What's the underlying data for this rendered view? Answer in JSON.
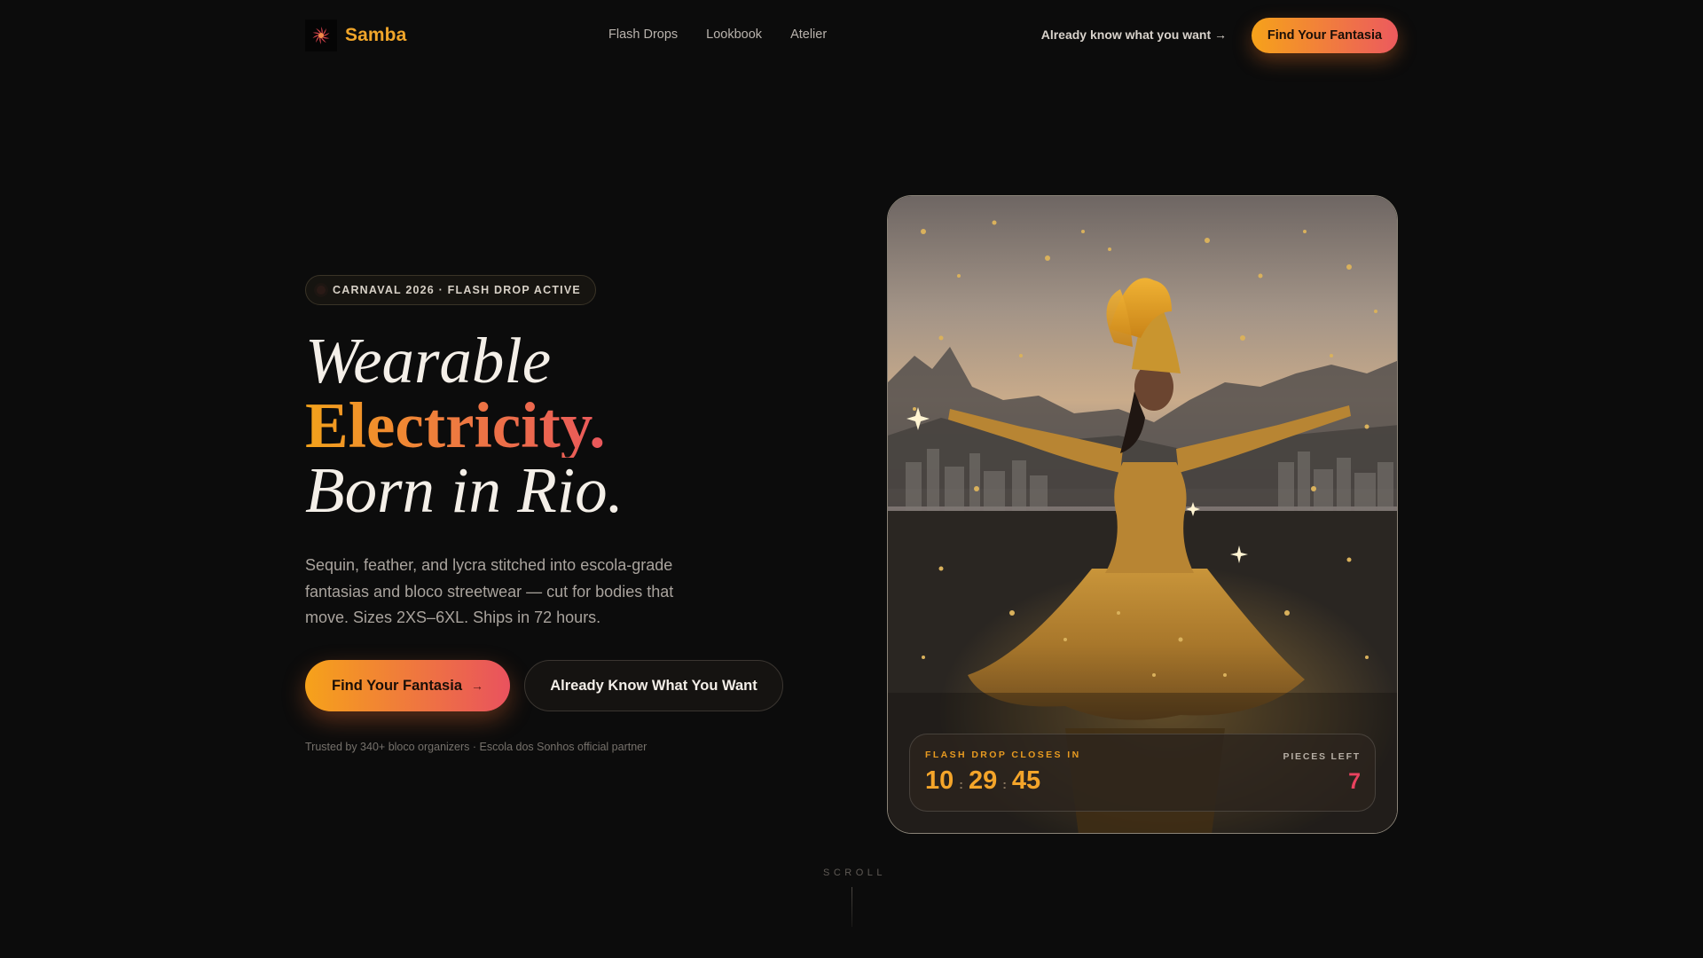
{
  "brand": {
    "name": "Samba",
    "logo_icon": "sun-burst-logo-icon",
    "accent": "#f0a52a"
  },
  "nav": {
    "items": [
      "Flash Drops",
      "Lookbook",
      "Atelier"
    ]
  },
  "header": {
    "secondary_link": "Already know what you want →",
    "cta": "Find Your Fantasia"
  },
  "hero": {
    "badge": "CARNAVAL 2026 · FLASH DROP ACTIVE",
    "headline": {
      "line1": "Wearable",
      "line2": "Electricity.",
      "line3": "Born in Rio."
    },
    "subcopy": "Sequin, feather, and lycra stitched into escola-grade fantasias and bloco streetwear — cut for bodies that move. Sizes 2XS–6XL. Ships in 72 hours.",
    "primary_cta": "Find Your Fantasia",
    "primary_cta_arrow": "→",
    "secondary_cta": "Already Know What You Want",
    "trust": "Trusted by 340+ bloco organizers · Escola dos Sonhos official partner"
  },
  "flash_drop": {
    "label": "FLASH DROP CLOSES IN",
    "hours": "10",
    "minutes": "29",
    "seconds": "45",
    "separator": ":",
    "pieces_label": "PIECES LEFT",
    "pieces_value": "7"
  },
  "scroll": {
    "label": "SCROLL"
  },
  "colors": {
    "gradient_start": "#f6a21a",
    "gradient_end": "#e9525e",
    "background": "#0c0c0c"
  }
}
